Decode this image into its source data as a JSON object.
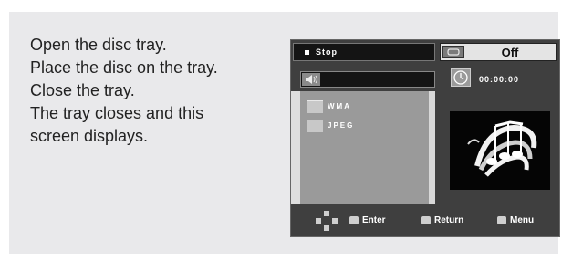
{
  "instructions": [
    "Open the disc tray.",
    "Place the disc on the tray.",
    "Close the tray.",
    "The tray closes and this",
    "screen displays."
  ],
  "osd": {
    "status": "Stop",
    "repeat_value": "Off",
    "time": "00:00:00",
    "files": [
      "WMA",
      "JPEG"
    ],
    "controls": {
      "enter": "Enter",
      "return": "Return",
      "menu": "Menu"
    },
    "icons": {
      "status": "stop-icon",
      "repeat": "repeat-icon",
      "audio": "speaker-icon",
      "time": "clock-icon",
      "navigate": "direction-pad-icon",
      "enter": "enter-button-icon",
      "return": "return-button-icon",
      "menu": "menu-button-icon"
    }
  }
}
